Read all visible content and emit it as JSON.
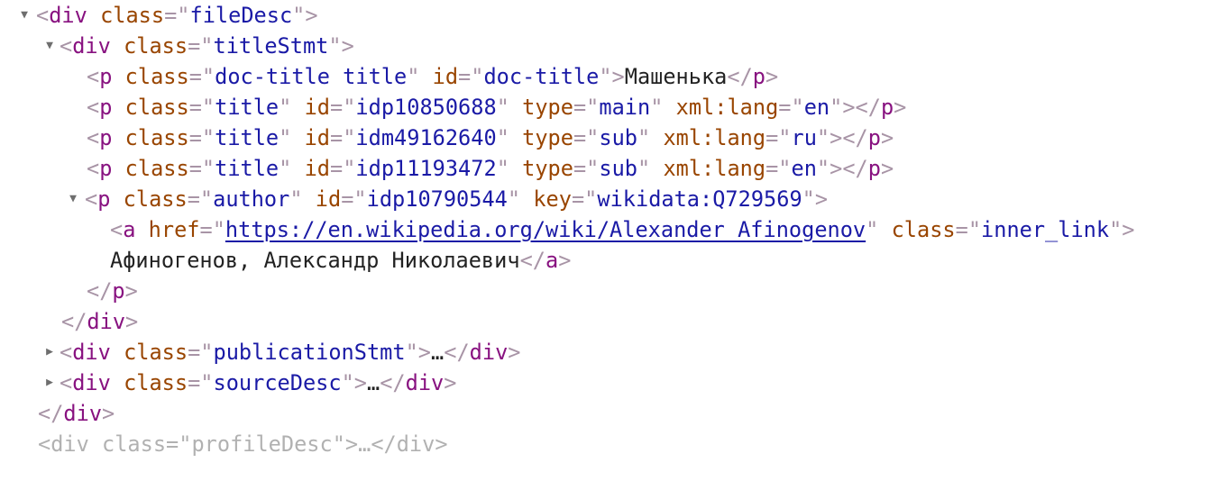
{
  "t": {
    "div": "div",
    "p": "p",
    "a": "a",
    "class": "class",
    "id": "id",
    "type": "type",
    "xml_lang": "xml:lang",
    "key": "key",
    "href": "href"
  },
  "lines": {
    "filedesc_class": "fileDesc",
    "titlestmt_class": "titleStmt",
    "doc_title": {
      "class": "doc-title title",
      "id": "doc-title",
      "text": "Машенька"
    },
    "title1": {
      "class": "title",
      "id": "idp10850688",
      "type": "main",
      "lang": "en"
    },
    "title2": {
      "class": "title",
      "id": "idm49162640",
      "type": "sub",
      "lang": "ru"
    },
    "title3": {
      "class": "title",
      "id": "idp11193472",
      "type": "sub",
      "lang": "en"
    },
    "author": {
      "class": "author",
      "id": "idp10790544",
      "key": "wikidata:Q729569"
    },
    "link": {
      "href": "https://en.wikipedia.org/wiki/Alexander_Afinogenov",
      "class": "inner_link",
      "text": "Афиногенов, Александр Николаевич"
    },
    "publication_class": "publicationStmt",
    "source_class": "sourceDesc",
    "ellipsis": "…",
    "partial": "<div class=\"profileDesc\">…</div>"
  }
}
